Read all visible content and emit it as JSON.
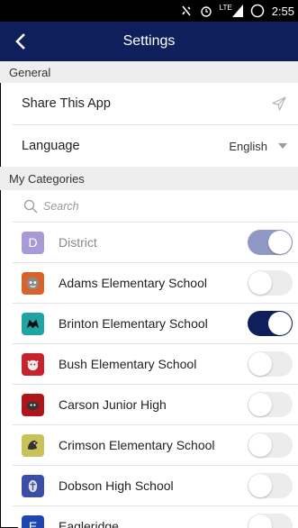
{
  "status_bar": {
    "time": "2:55",
    "network": "LTE"
  },
  "header": {
    "title": "Settings"
  },
  "sections": {
    "general": "General",
    "my_categories": "My Categories"
  },
  "general": {
    "share_label": "Share This App",
    "language_label": "Language",
    "language_value": "English"
  },
  "search": {
    "placeholder": "Search"
  },
  "categories": [
    {
      "name": "District",
      "letter": "D",
      "color": "#a79ad6",
      "enabled": true,
      "disabled": true
    },
    {
      "name": "Adams Elementary School",
      "color": "#d8622a",
      "enabled": false
    },
    {
      "name": "Brinton Elementary School",
      "color": "#1fa3a3",
      "enabled": true
    },
    {
      "name": "Bush Elementary School",
      "color": "#c8232c",
      "enabled": false
    },
    {
      "name": "Carson Junior High",
      "color": "#b0141b",
      "enabled": false
    },
    {
      "name": "Crimson Elementary School",
      "color": "#c9c25a",
      "enabled": false
    },
    {
      "name": "Dobson High School",
      "color": "#3a4ea8",
      "enabled": false
    },
    {
      "name": "Eagleridge",
      "letter": "E",
      "color": "#1e46b0",
      "enabled": false
    }
  ],
  "icons": {
    "back": "back-arrow-icon",
    "share": "share-plane-icon",
    "dropdown": "chevron-down-icon",
    "search": "search-icon"
  },
  "colors": {
    "primary": "#0f1f5c",
    "toggle_off": "#ececec",
    "section_bg": "#eeeeee"
  }
}
